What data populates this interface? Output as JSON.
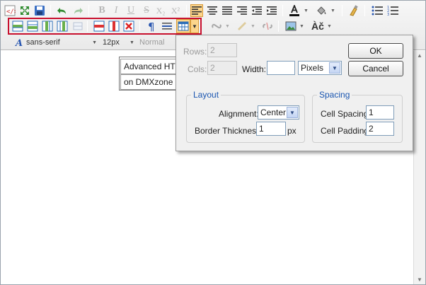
{
  "toolbar": {
    "font_family": "sans-serif",
    "font_size": "12px",
    "block_format": "Normal",
    "formatting_letters": {
      "bold": "B",
      "italic": "I",
      "underline": "U",
      "strike": "S",
      "subscript": "X₂",
      "superscript": "X²"
    },
    "special_char": "Àč",
    "icons": [
      "source-code-icon",
      "fullscreen-icon",
      "save-icon",
      "undo-icon",
      "redo-icon",
      "align-left-icon",
      "align-center-icon",
      "align-right-icon",
      "justify-icon",
      "outdent-icon",
      "indent-icon",
      "text-color-icon",
      "highlight-color-icon",
      "clean-format-icon",
      "bullet-list-icon",
      "numbered-list-icon",
      "insert-row-before-icon",
      "insert-row-after-icon",
      "insert-col-before-icon",
      "insert-col-after-icon",
      "merge-cells-icon",
      "delete-row-icon",
      "delete-col-icon",
      "delete-table-icon",
      "paragraph-mark-icon",
      "horizontal-rule-icon",
      "table-icon",
      "link-icon",
      "anchor-icon",
      "unlink-icon",
      "image-icon"
    ]
  },
  "document": {
    "cells": [
      "Advanced HT",
      "on DMXzone"
    ]
  },
  "dialog": {
    "rows_label": "Rows:",
    "rows_value": "2",
    "cols_label": "Cols:",
    "cols_value": "2",
    "width_label": "Width:",
    "width_value": "",
    "width_unit": "Pixels",
    "ok_label": "OK",
    "cancel_label": "Cancel",
    "layout": {
      "legend": "Layout",
      "alignment_label": "Alignment:",
      "alignment_value": "Center",
      "border_label": "Border Thickness:",
      "border_value": "1",
      "border_unit": "px"
    },
    "spacing": {
      "legend": "Spacing",
      "cell_spacing_label": "Cell Spacing:",
      "cell_spacing_value": "1",
      "cell_padding_label": "Cell Padding:",
      "cell_padding_value": "2"
    }
  },
  "colors": {
    "highlight_border": "#c8102e",
    "active_button": "#fcd58b",
    "legend_text": "#1a55b0"
  }
}
